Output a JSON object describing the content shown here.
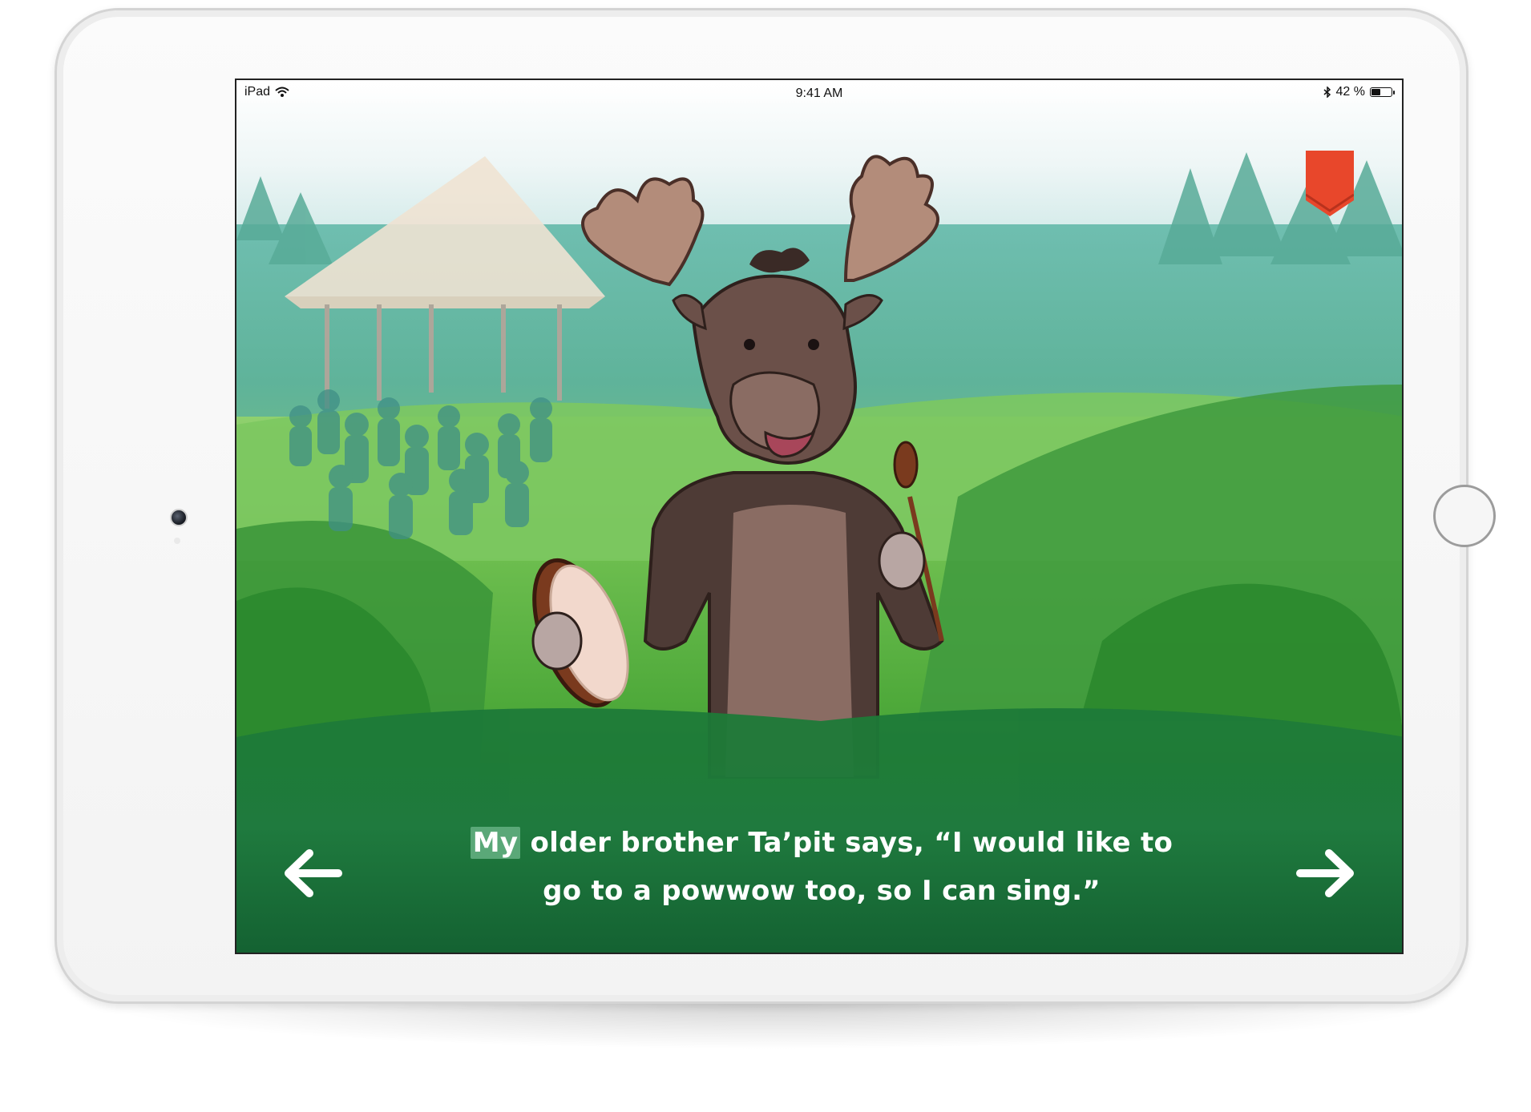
{
  "status_bar": {
    "device": "iPad",
    "time": "9:41 AM",
    "battery": "42 %",
    "battery_level": 0.42
  },
  "icons": {
    "wifi": "wifi-icon",
    "bluetooth": "bluetooth-icon",
    "battery": "battery-icon",
    "bookmark": "bookmark-icon",
    "prev": "arrow-left-icon",
    "next": "arrow-right-icon"
  },
  "story": {
    "highlighted_word": "My",
    "line1_rest": " older brother Ta’pit says, “I would like to",
    "line2": "go to a powwow too, so I can sing.”"
  },
  "colors": {
    "bookmark": "#e8472b",
    "highlight": "#5aa878",
    "text": "#ffffff"
  }
}
